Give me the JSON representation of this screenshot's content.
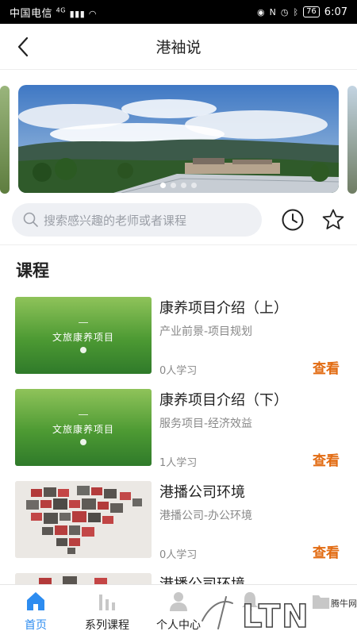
{
  "status_bar": {
    "carrier": "中国电信",
    "network": "4G",
    "battery": "76",
    "time": "6:07"
  },
  "header": {
    "title": "港袖说"
  },
  "banner": {
    "slide_count": 4,
    "active_index": 0
  },
  "search": {
    "placeholder": "搜索感兴趣的老师或者课程"
  },
  "section": {
    "title": "课程"
  },
  "courses": [
    {
      "title": "康养项目介绍（上）",
      "subtitle": "产业前景-项目规划",
      "learners": "0人学习",
      "action": "查看",
      "thumb_caption": "文旅康养项目"
    },
    {
      "title": "康养项目介绍（下）",
      "subtitle": "服务项目-经济效益",
      "learners": "1人学习",
      "action": "查看",
      "thumb_caption": "文旅康养项目"
    },
    {
      "title": "港播公司环境",
      "subtitle": "港播公司-办公环境",
      "learners": "0人学习",
      "action": "查看"
    },
    {
      "title": "港播公司环境"
    }
  ],
  "tabs": [
    {
      "label": "首页",
      "icon": "home-icon",
      "active": true
    },
    {
      "label": "系列课程",
      "icon": "bar-chart-icon",
      "active": false
    },
    {
      "label": "个人中心",
      "icon": "person-icon",
      "active": false
    },
    {
      "label": "",
      "icon": "bell-icon",
      "active": false
    },
    {
      "label": "",
      "icon": "folder-icon",
      "active": false
    }
  ],
  "watermark": {
    "text": "腾牛网"
  },
  "colors": {
    "accent": "#2d8cf0",
    "action": "#e26b12"
  }
}
